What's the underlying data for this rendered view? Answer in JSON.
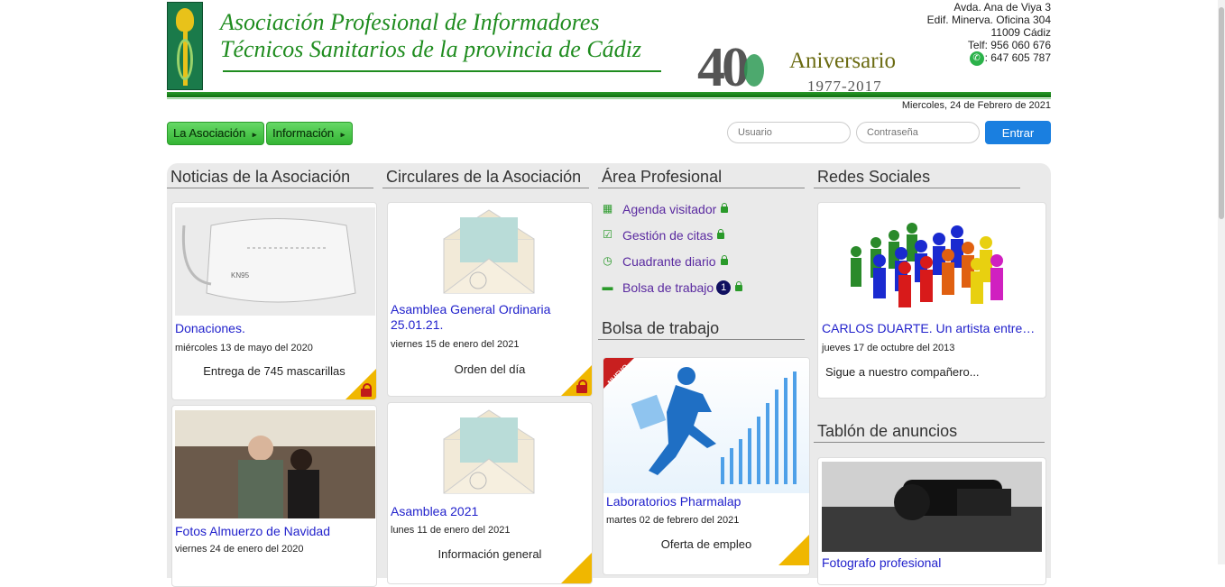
{
  "header": {
    "title_line1": "Asociación Profesional de Informadores",
    "title_line2": "Técnicos Sanitarios de la provincia de Cádiz",
    "anniversary_number": "40",
    "anniversary_label": "Aniversario",
    "anniversary_years": "1977-2017",
    "address": [
      "Avda. Ana de Viya 3",
      "Edif. Minerva. Oficina 304",
      "11009 Cádiz",
      "Telf: 956 060 676"
    ],
    "whatsapp": ": 647 605 787",
    "date": "Miercoles, 24 de Febrero de 2021"
  },
  "nav": {
    "items": [
      "La Asociación",
      "Información"
    ]
  },
  "login": {
    "user_placeholder": "Usuario",
    "password_placeholder": "Contraseña",
    "submit_label": "Entrar"
  },
  "columns": {
    "news": {
      "heading": "Noticias de la Asociación",
      "cards": [
        {
          "title": "Donaciones.",
          "date": "miércoles 13 de mayo del 2020",
          "desc": "Entrega de 745 mascarillas",
          "image_label": "KN95"
        },
        {
          "title": "Fotos Almuerzo de Navidad",
          "date": "viernes 24 de enero del 2020"
        }
      ]
    },
    "circulars": {
      "heading": "Circulares de la Asociación",
      "cards": [
        {
          "title": "Asamblea General Ordinaria 25.01.21.",
          "date": "viernes 15 de enero del 2021",
          "desc": "Orden del día"
        },
        {
          "title": "Asamblea 2021",
          "date": "lunes 11 de enero del 2021",
          "desc": "Información general"
        }
      ]
    },
    "professional": {
      "heading": "Área Profesional",
      "items": [
        "Agenda visitador",
        "Gestión de citas",
        "Cuadrante diario",
        "Bolsa de trabajo"
      ],
      "job_badge": "1",
      "jobs_heading": "Bolsa de trabajo",
      "job_card": {
        "ribbon": "NUEVO",
        "title": "Laboratorios Pharmalap",
        "date": "martes 02 de febrero del 2021",
        "desc": "Oferta de empleo"
      }
    },
    "social": {
      "heading": "Redes Sociales",
      "card": {
        "title": "CARLOS DUARTE. Un artista entre…",
        "date": "jueves 17 de octubre del 2013",
        "desc": "Sigue a nuestro compañero..."
      },
      "board_heading": "Tablón de anuncios",
      "board_card": {
        "title": "Fotografo profesional"
      }
    }
  },
  "colors": {
    "brand_green": "#1f8c1f",
    "link_blue": "#2222cc",
    "button_blue": "#1a7fe0",
    "lock_yellow": "#f0b700"
  }
}
